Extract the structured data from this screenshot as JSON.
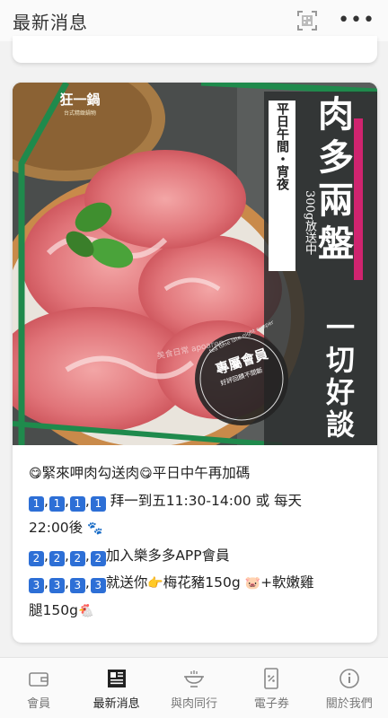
{
  "header": {
    "title": "最新消息",
    "scan_icon": "qr-scan-icon",
    "more_icon": "more-dots-icon",
    "more_text": "•••"
  },
  "banner": {
    "brand": "狂一鍋",
    "brand_sub": "台式精緻鍋物",
    "headline_chars": [
      "肉",
      "多",
      "兩",
      "盤"
    ],
    "tagline_chars": [
      "一",
      "切",
      "好",
      "談"
    ],
    "vertical_left": "平日午間・宵夜",
    "vertical_right": "300g放送中",
    "member_badge": "專屬會員",
    "member_sub": "好評回饋不間斷",
    "circle_text": "tea time late night supper",
    "watermark": "美食日常 apoaren",
    "colors": {
      "accent_green": "#1f8a4c",
      "accent_pink": "#d0246f",
      "meat": "#d9656a"
    }
  },
  "post": {
    "line1": {
      "emoji_a": "😋",
      "text": "緊來呷肉勾送肉",
      "emoji_b": "😋",
      "text2": "平日中午再加碼"
    },
    "line2": {
      "badges": [
        "1",
        "1",
        "1",
        "1"
      ],
      "text": " 拜一到五11:30-14:00 或 每天"
    },
    "line3": {
      "text": "22:00後 ",
      "emoji": "🐾"
    },
    "line4": {
      "badges": [
        "2",
        "2",
        "2",
        "2"
      ],
      "text": "加入樂多多APP會員"
    },
    "line5": {
      "badges": [
        "3",
        "3",
        "3",
        "3"
      ],
      "text": "就送你",
      "emoji_a": "👉",
      "text2": "梅花豬150g ",
      "emoji_b": "🐷",
      "text3": "+軟嫩雞"
    },
    "line6": {
      "text": "腿150g",
      "emoji": "🐔"
    }
  },
  "nav": {
    "items": [
      {
        "label": "會員",
        "icon": "wallet-icon"
      },
      {
        "label": "最新消息",
        "icon": "newspaper-icon",
        "active": true
      },
      {
        "label": "與肉同行",
        "icon": "hotpot-icon"
      },
      {
        "label": "電子券",
        "icon": "coupon-icon"
      },
      {
        "label": "關於我們",
        "icon": "info-icon"
      }
    ]
  }
}
